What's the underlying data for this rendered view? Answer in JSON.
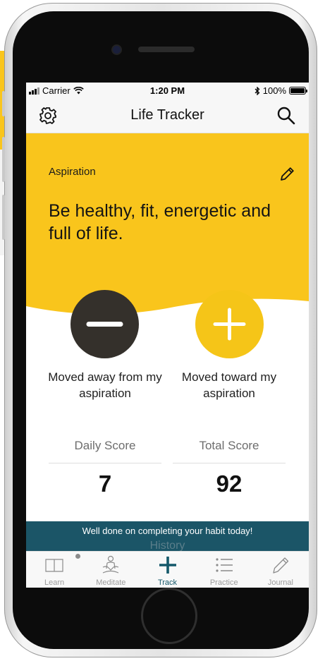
{
  "status_bar": {
    "carrier": "Carrier",
    "time": "1:20 PM",
    "battery": "100%"
  },
  "header": {
    "title": "Life Tracker"
  },
  "aspiration": {
    "label": "Aspiration",
    "text": "Be healthy, fit, energetic and full of life."
  },
  "actions": {
    "minus_label": "Moved away from my aspiration",
    "plus_label": "Moved toward my aspiration"
  },
  "scores": {
    "daily_label": "Daily Score",
    "daily_value": "7",
    "total_label": "Total Score",
    "total_value": "92"
  },
  "banner": {
    "message": "Well done on completing your habit today!",
    "ghost_text": "History"
  },
  "tabs": [
    {
      "label": "Learn",
      "icon": "book-icon"
    },
    {
      "label": "Meditate",
      "icon": "meditate-icon"
    },
    {
      "label": "Track",
      "icon": "plus-icon"
    },
    {
      "label": "Practice",
      "icon": "list-icon"
    },
    {
      "label": "Journal",
      "icon": "pencil-icon"
    }
  ],
  "active_tab": "Track",
  "colors": {
    "accent_yellow": "#f5c518",
    "dark_button": "#34302b",
    "banner_teal": "#1b5567",
    "active_tab": "#14586a"
  }
}
